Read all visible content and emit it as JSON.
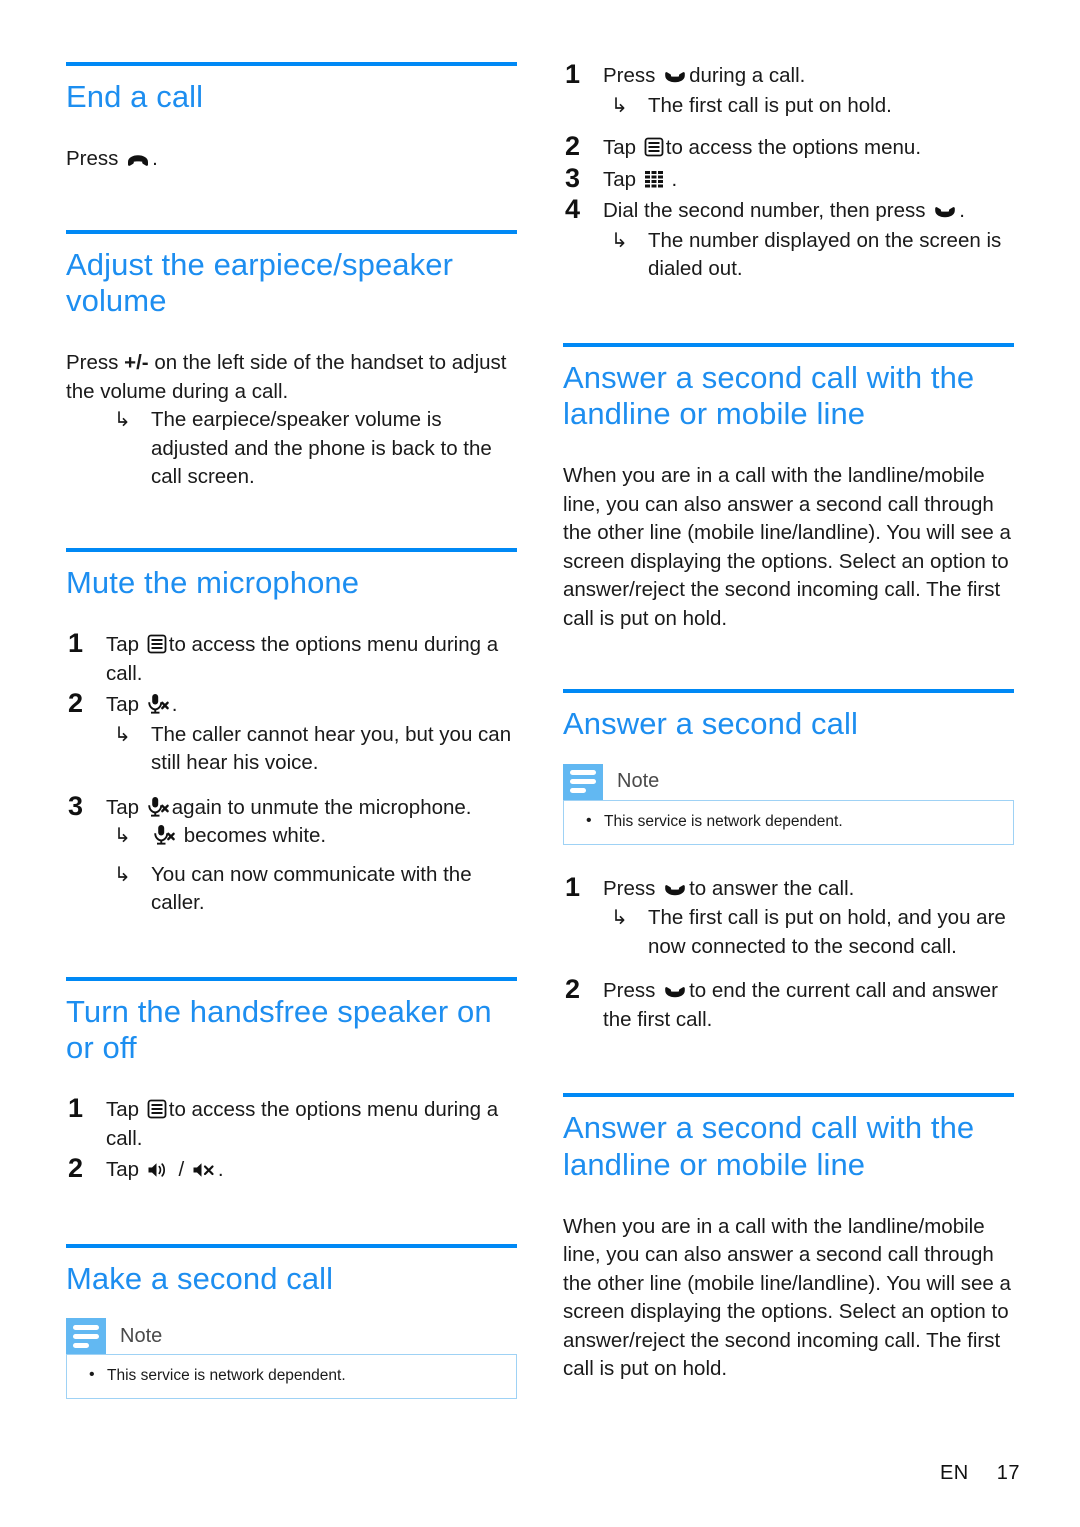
{
  "meta": {
    "footer_language": "EN",
    "footer_page": "17",
    "accent_color": "#1d8ef0",
    "rule_color": "#0089f5",
    "note_tab_color": "#62b8f2",
    "note_border_color": "#9fd2f5"
  },
  "left_column": {
    "sections": [
      {
        "id": "end-a-call",
        "heading": "End a call",
        "paragraph_prefix": "Press",
        "paragraph_icon": "end-call-icon",
        "paragraph_suffix": "."
      },
      {
        "id": "adjust-volume",
        "heading": "Adjust the earpiece/speaker volume",
        "paragraph_part1": "Press",
        "paragraph_bold": "+/-",
        "paragraph_part2": "on the left side of the handset to adjust the volume during a call.",
        "result": "The earpiece/speaker volume is adjusted and the phone is back to the call screen."
      },
      {
        "id": "mute-the-microphone",
        "heading": "Mute the microphone",
        "steps": [
          {
            "num": "1",
            "text_before": "Tap",
            "icon": "options-menu-icon",
            "text_after": "to access the options menu during a call."
          },
          {
            "num": "2",
            "text_before": "Tap",
            "icon": "mic-mute-icon",
            "text_after": ".",
            "results": [
              "The caller cannot hear you, but you can still hear his voice."
            ]
          },
          {
            "num": "3",
            "text_before": "Tap",
            "icon": "mic-mute-icon",
            "text_after": "again to unmute the microphone.",
            "results_with_icon": {
              "icon": "mic-mute-icon",
              "text": "becomes white."
            },
            "results": [
              "You can now communicate with the caller."
            ]
          }
        ]
      },
      {
        "id": "handsfree-speaker",
        "heading": "Turn the handsfree speaker on or off",
        "steps": [
          {
            "num": "1",
            "text_before": "Tap",
            "icon": "options-menu-icon",
            "text_after": "to access the options menu during a call."
          },
          {
            "num": "2",
            "text_before": "Tap",
            "icon": "speaker-on-icon",
            "separator": "/",
            "icon2": "speaker-off-icon",
            "text_after": "."
          }
        ]
      },
      {
        "id": "make-a-second-call",
        "heading": "Make a second call",
        "note": {
          "title": "Note",
          "items": [
            "This service is network dependent."
          ]
        }
      }
    ]
  },
  "right_column": {
    "top_steps": [
      {
        "num": "1",
        "text_before": "Press",
        "icon": "answer-call-icon",
        "text_after": "during a call.",
        "results": [
          "The first call is put on hold."
        ]
      },
      {
        "num": "2",
        "text_before": "Tap",
        "icon": "options-menu-icon",
        "text_after": "to access the options menu."
      },
      {
        "num": "3",
        "text_before": "Tap",
        "icon": "dialpad-icon",
        "text_after": "."
      },
      {
        "num": "4",
        "text_before": "Dial the second number, then press",
        "icon": "answer-call-icon",
        "text_after": ".",
        "results": [
          "The number displayed on the screen is dialed out."
        ]
      }
    ],
    "sections": [
      {
        "id": "answer-second-call-landline-mobile-1",
        "heading": "Answer a second call with the landline or mobile line",
        "paragraph": "When you are in a call with the landline/mobile line, you can also answer a second call through the other line (mobile line/landline). You will see a screen displaying the options. Select an option to answer/reject the second incoming call. The first call is put on hold."
      },
      {
        "id": "answer-a-second-call",
        "heading": "Answer a second call",
        "note": {
          "title": "Note",
          "items": [
            "This service is network dependent."
          ]
        },
        "steps": [
          {
            "num": "1",
            "text_before": "Press",
            "icon": "answer-call-icon",
            "text_after": "to answer the call.",
            "results": [
              "The first call is put on hold, and you are now connected to the second call."
            ]
          },
          {
            "num": "2",
            "text_before": "Press",
            "icon": "answer-call-icon",
            "text_after": "to end the current call and answer the first call."
          }
        ]
      },
      {
        "id": "answer-second-call-landline-mobile-2",
        "heading": "Answer a second call with the landline or mobile line",
        "paragraph": "When you are in a call with the landline/mobile line, you can also answer a second call through the other line (mobile line/landline). You will see a screen displaying the options. Select an option to answer/reject the second incoming call. The first call is put on hold."
      }
    ]
  }
}
